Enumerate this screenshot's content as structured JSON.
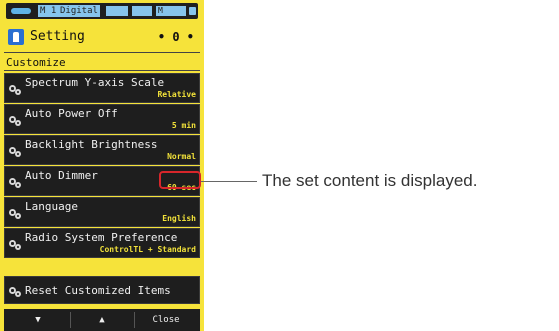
{
  "status_bar": {
    "mode": "M 1",
    "type": "Digital",
    "memory": "M"
  },
  "header": {
    "title": "Setting",
    "page_indicator": "• 0 •",
    "icon": "setting-icon"
  },
  "section": {
    "title": "Customize"
  },
  "menu": {
    "items": [
      {
        "label": "Spectrum Y-axis Scale",
        "value": "Relative"
      },
      {
        "label": "Auto Power Off",
        "value": "5 min"
      },
      {
        "label": "Backlight Brightness",
        "value": "Normal"
      },
      {
        "label": "Auto Dimmer",
        "value": "60 sec"
      },
      {
        "label": "Language",
        "value": "English"
      },
      {
        "label": "Radio System Preference",
        "value": "ControlTL + Standard"
      }
    ],
    "reset_label": "Reset Customized Items"
  },
  "nav": {
    "down": "▼",
    "up": "▲",
    "close": "Close"
  },
  "annotation": {
    "text": "The set content is displayed."
  },
  "colors": {
    "screen_background": "#f6e33a",
    "item_background": "#1e1e1e",
    "value_text": "#f2e23a",
    "highlight": "#d7262b",
    "status_accent": "#86c4ec"
  }
}
